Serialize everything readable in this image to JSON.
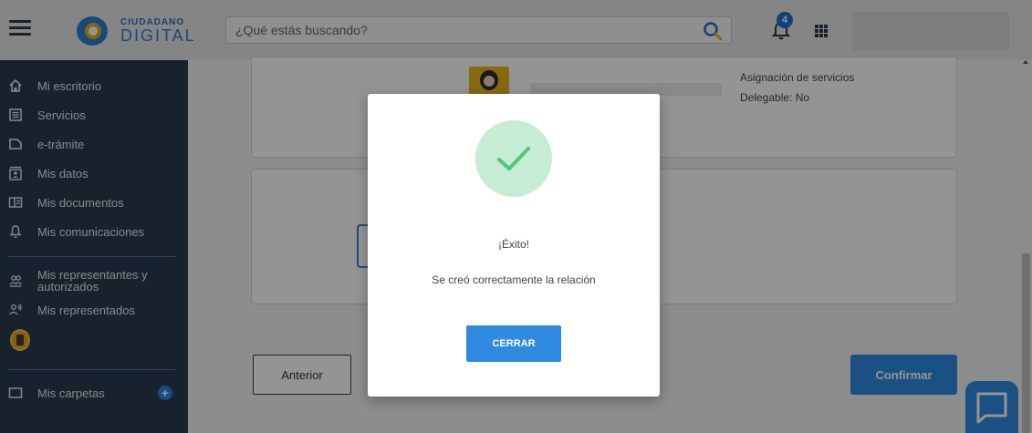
{
  "header": {
    "logo_top": "CIUDADANO",
    "logo_bottom": "DIGITAL",
    "search_placeholder": "¿Qué estás buscando?",
    "notification_count": "4"
  },
  "sidebar": {
    "items": [
      {
        "label": "Mi escritorio",
        "icon": "home-icon"
      },
      {
        "label": "Servicios",
        "icon": "list-icon"
      },
      {
        "label": "e-trámite",
        "icon": "tag-icon"
      },
      {
        "label": "Mis datos",
        "icon": "id-card-icon"
      },
      {
        "label": "Mis documentos",
        "icon": "documents-icon"
      },
      {
        "label": "Mis comunicaciones",
        "icon": "bell-icon"
      },
      {
        "label_line1": "Mis representantes y",
        "label_line2": "autorizados",
        "icon": "users-icon"
      },
      {
        "label": "Mis representados",
        "icon": "user-voice-icon"
      }
    ],
    "folders_label": "Mis carpetas"
  },
  "main": {
    "info_line1": "Asignación de servicios",
    "info_line2": "Delegable: No",
    "btn_anterior": "Anterior",
    "btn_confirmar": "Confirmar"
  },
  "modal": {
    "title": "¡Éxito!",
    "message": "Se creó correctamente la relación",
    "close_label": "CERRAR"
  },
  "colors": {
    "sidebar_bg": "#2a3b4e",
    "accent": "#2f8ae0",
    "success": "#4fc879"
  }
}
